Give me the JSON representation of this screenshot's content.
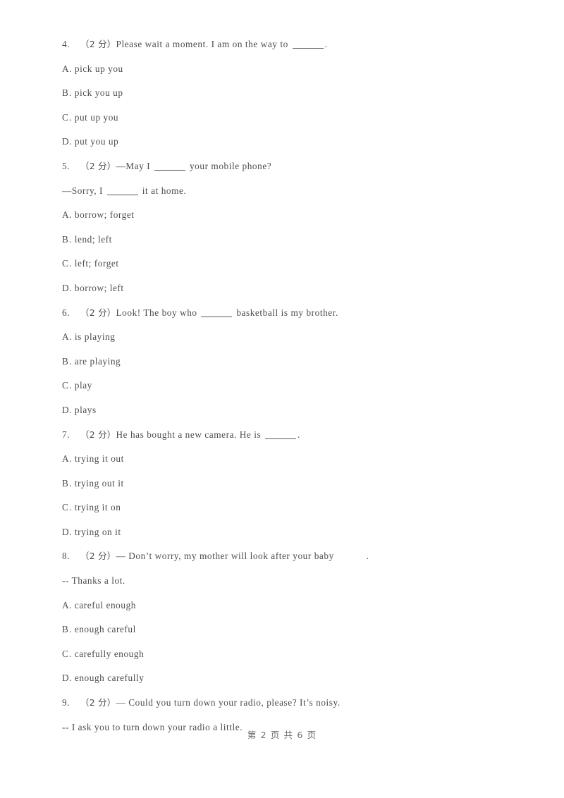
{
  "document": {
    "type": "exam-paper",
    "language": "en-with-chinese-annotations",
    "text_color": "#4d4d4d",
    "background_color": "#ffffff"
  },
  "questions": [
    {
      "number": "4.",
      "marks": "（2 分）",
      "stem_parts": [
        {
          "kind": "text",
          "value": "Please wait a moment. I am on the way to "
        },
        {
          "kind": "blank"
        },
        {
          "kind": "text",
          "value": "."
        }
      ],
      "stem_plain": "Please wait a moment. I am on the way to ______.",
      "options": [
        {
          "letter": "A",
          "sep": ".",
          "text": "pick up you"
        },
        {
          "letter": "B",
          "sep": ".",
          "text": "pick you up"
        },
        {
          "letter": "C",
          "sep": ".",
          "text": "put up you"
        },
        {
          "letter": "D",
          "sep": ".",
          "text": "put you up"
        }
      ]
    },
    {
      "number": "5.",
      "marks": "（2 分）",
      "stem_parts": [
        {
          "kind": "text",
          "value": "—May I "
        },
        {
          "kind": "blank"
        },
        {
          "kind": "text",
          "value": " your mobile phone?"
        }
      ],
      "stem_plain": "—May I ______ your mobile phone?",
      "continuation_parts": [
        {
          "kind": "text",
          "value": "—Sorry, I "
        },
        {
          "kind": "blank"
        },
        {
          "kind": "text",
          "value": " it at home."
        }
      ],
      "continuation_plain": "—Sorry, I ______ it at home.",
      "options": [
        {
          "letter": "A",
          "sep": ".",
          "text": "borrow; forget"
        },
        {
          "letter": "B",
          "sep": ".",
          "text": "lend; left"
        },
        {
          "letter": "C",
          "sep": ".",
          "text": "left; forget"
        },
        {
          "letter": "D",
          "sep": ".",
          "text": "borrow; left"
        }
      ]
    },
    {
      "number": "6.",
      "marks": "（2 分）",
      "stem_parts": [
        {
          "kind": "text",
          "value": "Look! The boy who "
        },
        {
          "kind": "blank"
        },
        {
          "kind": "text",
          "value": " basketball is my brother."
        }
      ],
      "stem_plain": "Look! The boy who ______ basketball is my brother.",
      "options": [
        {
          "letter": "A",
          "sep": ".",
          "text": "is playing"
        },
        {
          "letter": "B",
          "sep": ".",
          "text": "are playing"
        },
        {
          "letter": "C",
          "sep": ".",
          "text": "play"
        },
        {
          "letter": "D",
          "sep": ".",
          "text": "plays"
        }
      ]
    },
    {
      "number": "7.",
      "marks": "（2 分）",
      "stem_parts": [
        {
          "kind": "text",
          "value": "He has bought a new camera. He is "
        },
        {
          "kind": "blank"
        },
        {
          "kind": "text",
          "value": "."
        }
      ],
      "stem_plain": "He has bought a new camera. He is ______.",
      "options": [
        {
          "letter": "A",
          "sep": ".",
          "text": "trying it out"
        },
        {
          "letter": "B",
          "sep": ".",
          "text": "trying out it"
        },
        {
          "letter": "C",
          "sep": ".",
          "text": "trying it on"
        },
        {
          "letter": "D",
          "sep": ".",
          "text": "trying on it"
        }
      ]
    },
    {
      "number": "8.",
      "marks": "（2 分）",
      "stem_parts": [
        {
          "kind": "text",
          "value": "— Don’t worry, my mother will look after your baby"
        },
        {
          "kind": "gap"
        },
        {
          "kind": "text",
          "value": "."
        }
      ],
      "stem_plain": "— Don’t worry, my mother will look after your baby        .",
      "continuation_parts": [
        {
          "kind": "text",
          "value": "-- Thanks a lot."
        }
      ],
      "continuation_plain": "-- Thanks a lot.",
      "options": [
        {
          "letter": "A",
          "sep": ".",
          "text": "careful enough"
        },
        {
          "letter": "B",
          "sep": ".",
          "text": "enough careful"
        },
        {
          "letter": "C",
          "sep": ".",
          "text": "carefully enough"
        },
        {
          "letter": "D",
          "sep": ".",
          "text": "enough carefully"
        }
      ]
    },
    {
      "number": "9.",
      "marks": "（2 分）",
      "stem_parts": [
        {
          "kind": "text",
          "value": "— Could you turn down your radio, please? It’s noisy."
        }
      ],
      "stem_plain": "— Could you turn down your radio, please? It’s noisy.",
      "continuation_parts": [
        {
          "kind": "text",
          "value": "-- I ask you to turn down your radio a little."
        }
      ],
      "continuation_plain": "-- I ask you to turn down your radio a little.",
      "options": []
    }
  ],
  "footer": {
    "text": "第 2 页 共 6 页",
    "current_page": "2",
    "total_pages": "6"
  }
}
